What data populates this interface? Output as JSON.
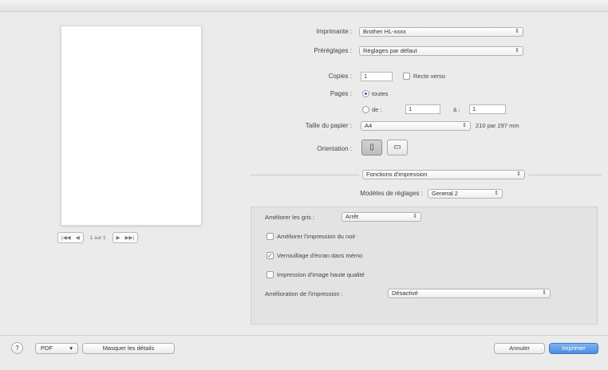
{
  "preview": {
    "pager": {
      "first": "|◀◀",
      "prev": "◀",
      "page_text": "1 sur 1",
      "next": "▶",
      "last": "▶▶|"
    }
  },
  "printer": {
    "label": "Imprimante :",
    "value": "Brother HL-xxxx"
  },
  "presets": {
    "label": "Préréglages :",
    "value": "Réglages par défaut"
  },
  "copies": {
    "label": "Copies :",
    "value": "1",
    "duplex_label": "Recto verso"
  },
  "pages": {
    "label": "Pages :",
    "all_label": "toutes",
    "from_label": "de :",
    "from_value": "1",
    "to_label": "à :",
    "to_value": "1"
  },
  "paper": {
    "label": "Taille du papier :",
    "value": "A4",
    "size_text": "210 par 297 mm"
  },
  "orientation": {
    "label": "Orientation :",
    "portrait_icon": "portrait-orientation-icon",
    "landscape_icon": "landscape-orientation-icon"
  },
  "section_popup": {
    "value": "Fonctions d'impression"
  },
  "settings_mode": {
    "label": "Modèles de réglages :",
    "value": "General 2"
  },
  "panel": {
    "gray_label": "Améliorer les gris :",
    "gray_value": "Arrêt",
    "black_print_label": "Améliorer l'impression du noir",
    "black_print_checked": false,
    "skip_blank_label": "Verrouillage d'écran dans mémo",
    "skip_blank_checked": true,
    "hq_image_label": "Impression d'image haute qualité",
    "hq_image_checked": false,
    "output_label": "Amélioration de l'impression :",
    "output_value": "Désactivé"
  },
  "footer": {
    "help": "?",
    "pdf_label": "PDF",
    "hide_details": "Masquer les détails",
    "cancel": "Annuler",
    "print": "Imprimer"
  },
  "colors": {
    "accent": "#4a8de0",
    "window_bg": "#ebebeb",
    "panel_bg": "#e3e3e3"
  }
}
